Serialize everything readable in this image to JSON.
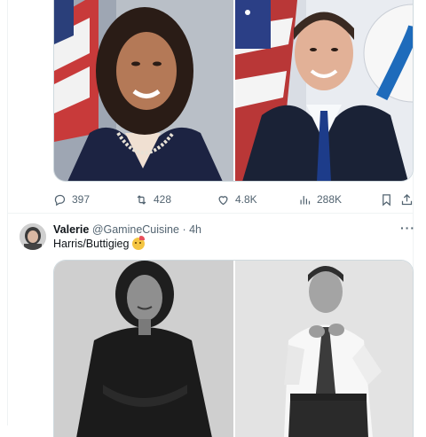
{
  "post1": {
    "actions": {
      "reply_count": "397",
      "repost_count": "428",
      "like_count": "4.8K",
      "view_count": "288K"
    }
  },
  "post2": {
    "author_name": "Valerie",
    "author_handle": "@GamineCuisine",
    "separator": "·",
    "time": "4h",
    "more": "···",
    "text": "Harris/Buttigieg"
  },
  "colors": {
    "text_primary": "#0f1419",
    "text_secondary": "#536471",
    "border": "#eff3f4"
  },
  "icons": [
    "reply-icon",
    "repost-icon",
    "like-icon",
    "views-icon",
    "bookmark-icon",
    "share-icon",
    "more-icon"
  ]
}
